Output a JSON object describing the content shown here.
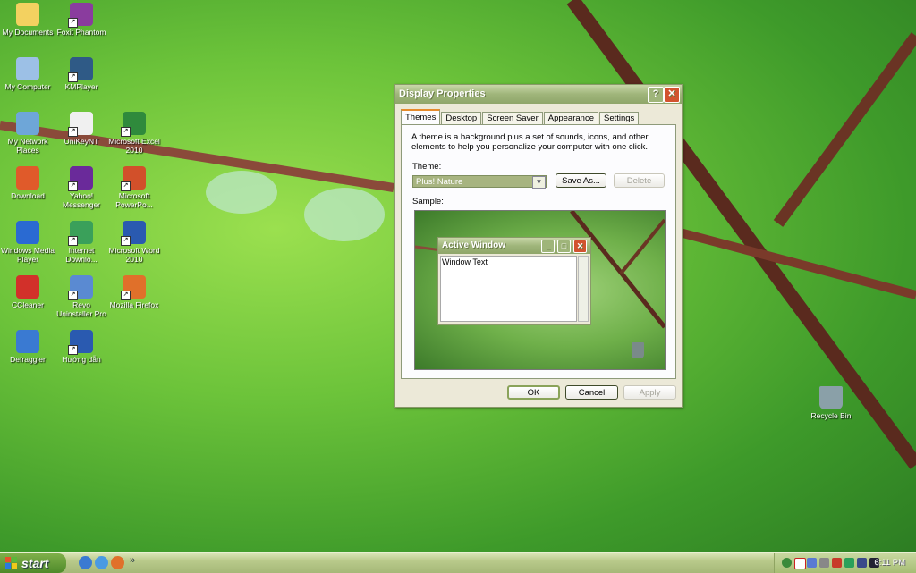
{
  "desktop": {
    "icons": [
      {
        "label": "My Documents",
        "icon": "folder-documents-icon",
        "color": "#f3d160"
      },
      {
        "label": "Foxit Phantom",
        "icon": "foxit-phantom-icon",
        "color": "#8a3c9e"
      },
      {
        "label": "My Computer",
        "icon": "computer-icon",
        "color": "#9cc0e6"
      },
      {
        "label": "KMPlayer",
        "icon": "kmplayer-icon",
        "color": "#2f5a86"
      },
      {
        "label": "My Network Places",
        "icon": "network-places-icon",
        "color": "#6ea6d8"
      },
      {
        "label": "UniKeyNT",
        "icon": "unikey-icon",
        "color": "#f0f0f0"
      },
      {
        "label": "Microsoft Excel 2010",
        "icon": "excel-icon",
        "color": "#2f8a3c"
      },
      {
        "label": "Download",
        "icon": "download-icon",
        "color": "#e05a2a"
      },
      {
        "label": "Yahoo! Messenger",
        "icon": "yahoo-messenger-icon",
        "color": "#6a2a9a"
      },
      {
        "label": "Microsoft PowerPo...",
        "icon": "powerpoint-icon",
        "color": "#d2502a"
      },
      {
        "label": "Windows Media Player",
        "icon": "media-player-icon",
        "color": "#2a6ad2"
      },
      {
        "label": "Internet Downlo...",
        "icon": "internet-download-icon",
        "color": "#3aa05a"
      },
      {
        "label": "Microsoft Word 2010",
        "icon": "word-icon",
        "color": "#2a5ab0"
      },
      {
        "label": "CCleaner",
        "icon": "ccleaner-icon",
        "color": "#d2302a"
      },
      {
        "label": "Revo Uninstaller Pro",
        "icon": "revo-uninstaller-icon",
        "color": "#5a8ad2"
      },
      {
        "label": "Mozilla Firefox",
        "icon": "firefox-icon",
        "color": "#e0702a"
      },
      {
        "label": "Defraggler",
        "icon": "defraggler-icon",
        "color": "#3a7ad2"
      },
      {
        "label": "Hướng dẫn",
        "icon": "word-document-icon",
        "color": "#2a5ab0"
      },
      {
        "label": "Recycle Bin",
        "icon": "recycle-bin-icon",
        "color": "#8aa0a8"
      }
    ]
  },
  "dialog": {
    "title": "Display Properties",
    "help_label": "?",
    "close_label": "✕",
    "tabs": [
      "Themes",
      "Desktop",
      "Screen Saver",
      "Appearance",
      "Settings"
    ],
    "description": "A theme is a background plus a set of sounds, icons, and other elements to help you personalize your computer with one click.",
    "theme_label": "Theme:",
    "theme_value": "Plus! Nature",
    "save_as": "Save As...",
    "delete": "Delete",
    "sample_label": "Sample:",
    "sample_window_title": "Active Window",
    "sample_window_text": "Window Text",
    "ok": "OK",
    "cancel": "Cancel",
    "apply": "Apply"
  },
  "taskbar": {
    "start_label": "start",
    "clock": "6:11 PM",
    "more": "»"
  },
  "colors": {
    "accent_title": "#9fb57a",
    "tab_highlight": "#e68b2c",
    "taskbar": "#b8c98a"
  }
}
